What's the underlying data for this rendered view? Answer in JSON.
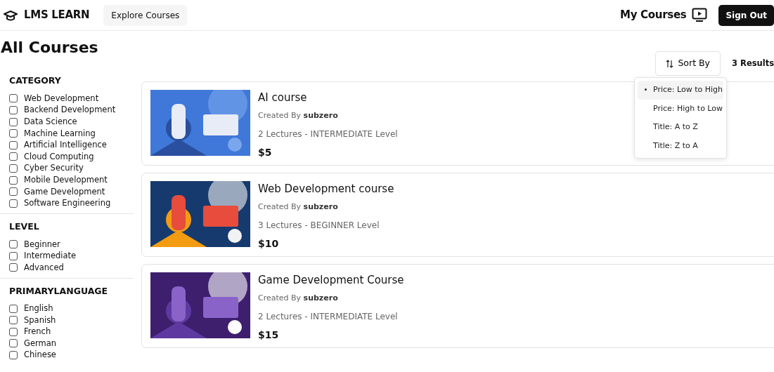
{
  "header": {
    "brand": "LMS LEARN",
    "explore_button": "Explore Courses",
    "my_courses": "My Courses",
    "sign_out": "Sign Out"
  },
  "page_title": "All Courses",
  "filters": [
    {
      "title": "CATEGORY",
      "options": [
        {
          "label": "Web Development",
          "checked": false
        },
        {
          "label": "Backend Development",
          "checked": false
        },
        {
          "label": "Data Science",
          "checked": false
        },
        {
          "label": "Machine Learning",
          "checked": false
        },
        {
          "label": "Artificial Intelligence",
          "checked": false
        },
        {
          "label": "Cloud Computing",
          "checked": false
        },
        {
          "label": "Cyber Security",
          "checked": false
        },
        {
          "label": "Mobile Development",
          "checked": false
        },
        {
          "label": "Game Development",
          "checked": false
        },
        {
          "label": "Software Engineering",
          "checked": false
        }
      ]
    },
    {
      "title": "LEVEL",
      "options": [
        {
          "label": "Beginner",
          "checked": false
        },
        {
          "label": "Intermediate",
          "checked": false
        },
        {
          "label": "Advanced",
          "checked": false
        }
      ]
    },
    {
      "title": "PRIMARYLANGUAGE",
      "options": [
        {
          "label": "English",
          "checked": false
        },
        {
          "label": "Spanish",
          "checked": false
        },
        {
          "label": "French",
          "checked": false
        },
        {
          "label": "German",
          "checked": false
        },
        {
          "label": "Chinese",
          "checked": false
        }
      ]
    }
  ],
  "sort": {
    "button": "Sort By",
    "results": "3 Results",
    "options": [
      {
        "label": "Price: Low to High",
        "selected": true
      },
      {
        "label": "Price: High to Low",
        "selected": false
      },
      {
        "label": "Title: A to Z",
        "selected": false
      },
      {
        "label": "Title: Z to A",
        "selected": false
      }
    ]
  },
  "courses": [
    {
      "title": "AI course",
      "created_by": "Created By",
      "author": "subzero",
      "details": "2 Lectures - INTERMEDIATE Level",
      "price": "$5"
    },
    {
      "title": "Web Development course",
      "created_by": "Created By",
      "author": "subzero",
      "details": "3 Lectures - BEGINNER Level",
      "price": "$10"
    },
    {
      "title": "Game Development Course",
      "created_by": "Created By",
      "author": "subzero",
      "details": "2 Lectures - INTERMEDIATE Level",
      "price": "$15"
    }
  ]
}
